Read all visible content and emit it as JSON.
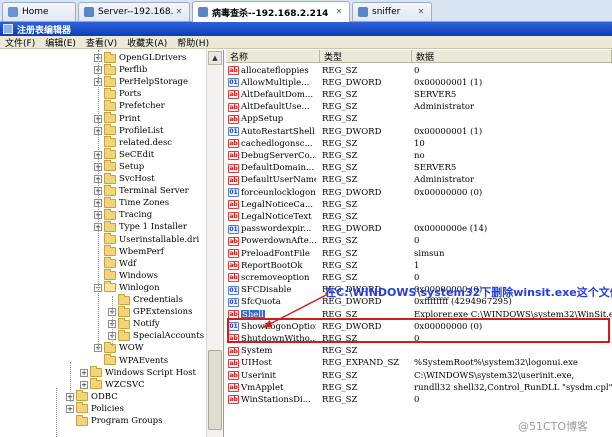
{
  "tabs": [
    {
      "label": "Home",
      "active": false,
      "icon": "home-icon",
      "closable": false
    },
    {
      "label": "Server--192.168.2.4",
      "active": false,
      "icon": "monitor-icon",
      "closable": true
    },
    {
      "label": "病毒查杀--192.168.2.214",
      "active": true,
      "icon": "monitor-icon",
      "closable": true
    },
    {
      "label": "sniffer",
      "active": false,
      "icon": "monitor-icon",
      "closable": true
    }
  ],
  "window_title": "注册表编辑器",
  "menu": [
    "文件(F)",
    "编辑(E)",
    "查看(V)",
    "收藏夹(A)",
    "帮助(H)"
  ],
  "tree": [
    {
      "label": "OpenGLDrivers",
      "level": 0,
      "exp": "+",
      "open": false
    },
    {
      "label": "Perflib",
      "level": 0,
      "exp": "+",
      "open": false
    },
    {
      "label": "PerHelpStorage",
      "level": 0,
      "exp": "+",
      "open": false
    },
    {
      "label": "Ports",
      "level": 0,
      "exp": "",
      "open": false
    },
    {
      "label": "Prefetcher",
      "level": 0,
      "exp": "",
      "open": false
    },
    {
      "label": "Print",
      "level": 0,
      "exp": "+",
      "open": false
    },
    {
      "label": "ProfileList",
      "level": 0,
      "exp": "+",
      "open": false
    },
    {
      "label": "related.desc",
      "level": 0,
      "exp": "",
      "open": false
    },
    {
      "label": "SeCEdit",
      "level": 0,
      "exp": "+",
      "open": false
    },
    {
      "label": "Setup",
      "level": 0,
      "exp": "+",
      "open": false
    },
    {
      "label": "SvcHost",
      "level": 0,
      "exp": "+",
      "open": false
    },
    {
      "label": "Terminal Server",
      "level": 0,
      "exp": "+",
      "open": false
    },
    {
      "label": "Time Zones",
      "level": 0,
      "exp": "+",
      "open": false
    },
    {
      "label": "Tracing",
      "level": 0,
      "exp": "+",
      "open": false
    },
    {
      "label": "Type 1 Installer",
      "level": 0,
      "exp": "+",
      "open": false
    },
    {
      "label": "Userinstallable.dri",
      "level": 0,
      "exp": "",
      "open": false
    },
    {
      "label": "WbemPerf",
      "level": 0,
      "exp": "",
      "open": false
    },
    {
      "label": "Wdf",
      "level": 0,
      "exp": "",
      "open": false
    },
    {
      "label": "Windows",
      "level": 0,
      "exp": "",
      "open": false
    },
    {
      "label": "Winlogon",
      "level": 0,
      "exp": "-",
      "open": true
    },
    {
      "label": "Credentials",
      "level": 1,
      "exp": "",
      "open": false
    },
    {
      "label": "GPExtensions",
      "level": 1,
      "exp": "+",
      "open": false
    },
    {
      "label": "Notify",
      "level": 1,
      "exp": "+",
      "open": false
    },
    {
      "label": "SpecialAccounts",
      "level": 1,
      "exp": "+",
      "open": false
    },
    {
      "label": "WOW",
      "level": 0,
      "exp": "+",
      "open": false
    },
    {
      "label": "WPAEvents",
      "level": 0,
      "exp": "",
      "open": false
    },
    {
      "label": "Windows Script Host",
      "level": -1,
      "exp": "+",
      "open": false
    },
    {
      "label": "WZCSVC",
      "level": -1,
      "exp": "+",
      "open": false
    },
    {
      "label": "ODBC",
      "level": -2,
      "exp": "+",
      "open": false
    },
    {
      "label": "Policies",
      "level": -2,
      "exp": "+",
      "open": false
    },
    {
      "label": "Program Groups",
      "level": -2,
      "exp": "",
      "open": false
    }
  ],
  "columns": {
    "name": "名称",
    "type": "类型",
    "data": "数据"
  },
  "rows": [
    {
      "name": "allocatefloppies",
      "type": "REG_SZ",
      "data": "0",
      "icon": "sz"
    },
    {
      "name": "AllowMultiple...",
      "type": "REG_DWORD",
      "data": "0x00000001 (1)",
      "icon": "num"
    },
    {
      "name": "AltDefaultDom...",
      "type": "REG_SZ",
      "data": "SERVER5",
      "icon": "sz"
    },
    {
      "name": "AltDefaultUse...",
      "type": "REG_SZ",
      "data": "Administrator",
      "icon": "sz"
    },
    {
      "name": "AppSetup",
      "type": "REG_SZ",
      "data": "",
      "icon": "sz"
    },
    {
      "name": "AutoRestartShell",
      "type": "REG_DWORD",
      "data": "0x00000001 (1)",
      "icon": "num"
    },
    {
      "name": "cachedlogonsc...",
      "type": "REG_SZ",
      "data": "10",
      "icon": "sz"
    },
    {
      "name": "DebugServerCo...",
      "type": "REG_SZ",
      "data": "no",
      "icon": "sz"
    },
    {
      "name": "DefaultDomain...",
      "type": "REG_SZ",
      "data": "SERVER5",
      "icon": "sz"
    },
    {
      "name": "DefaultUserName",
      "type": "REG_SZ",
      "data": "Administrator",
      "icon": "sz"
    },
    {
      "name": "forceunlocklogon",
      "type": "REG_DWORD",
      "data": "0x00000000 (0)",
      "icon": "num"
    },
    {
      "name": "LegalNoticeCa...",
      "type": "REG_SZ",
      "data": "",
      "icon": "sz"
    },
    {
      "name": "LegalNoticeText",
      "type": "REG_SZ",
      "data": "",
      "icon": "sz"
    },
    {
      "name": "passwordexpir...",
      "type": "REG_DWORD",
      "data": "0x0000000e (14)",
      "icon": "num"
    },
    {
      "name": "PowerdownAfte...",
      "type": "REG_SZ",
      "data": "0",
      "icon": "sz"
    },
    {
      "name": "PreloadFontFile",
      "type": "REG_SZ",
      "data": "simsun",
      "icon": "sz"
    },
    {
      "name": "ReportBootOk",
      "type": "REG_SZ",
      "data": "1",
      "icon": "sz"
    },
    {
      "name": "scremoveoption",
      "type": "REG_SZ",
      "data": "0",
      "icon": "sz"
    },
    {
      "name": "SFCDisable",
      "type": "REG_DWORD",
      "data": "0x00000000 (0)",
      "icon": "num"
    },
    {
      "name": "SfcQuota",
      "type": "REG_DWORD",
      "data": "0xffffffff (4294967295)",
      "icon": "num"
    },
    {
      "name": "Shell",
      "type": "REG_SZ",
      "data": "Explorer.exe C:\\WINDOWS\\system32\\WinSit.exe",
      "icon": "sz",
      "selected": true
    },
    {
      "name": "ShowLogonOptions",
      "type": "REG_DWORD",
      "data": "0x00000000 (0)",
      "icon": "num"
    },
    {
      "name": "ShutdownWitho...",
      "type": "REG_SZ",
      "data": "0",
      "icon": "sz"
    },
    {
      "name": "System",
      "type": "REG_SZ",
      "data": "",
      "icon": "sz"
    },
    {
      "name": "UIHost",
      "type": "REG_EXPAND_SZ",
      "data": "%SystemRoot%\\system32\\logonui.exe",
      "icon": "sz"
    },
    {
      "name": "Userinit",
      "type": "REG_SZ",
      "data": "C:\\WINDOWS\\system32\\userinit.exe,",
      "icon": "sz"
    },
    {
      "name": "VmApplet",
      "type": "REG_SZ",
      "data": "rundll32 shell32,Control_RunDLL \"sysdm.cpl\"",
      "icon": "sz"
    },
    {
      "name": "WinStationsDi...",
      "type": "REG_SZ",
      "data": "0",
      "icon": "sz"
    }
  ],
  "annotation": "在C:\\WINDOWS\\system32下删除winsit.exe这个文件",
  "watermark": "@51CTO博客",
  "colors": {
    "annotation": "#2440d8",
    "highlight_box": "#d21c1c",
    "selection": "#316ac5",
    "titlebar": "#0b3db6"
  }
}
